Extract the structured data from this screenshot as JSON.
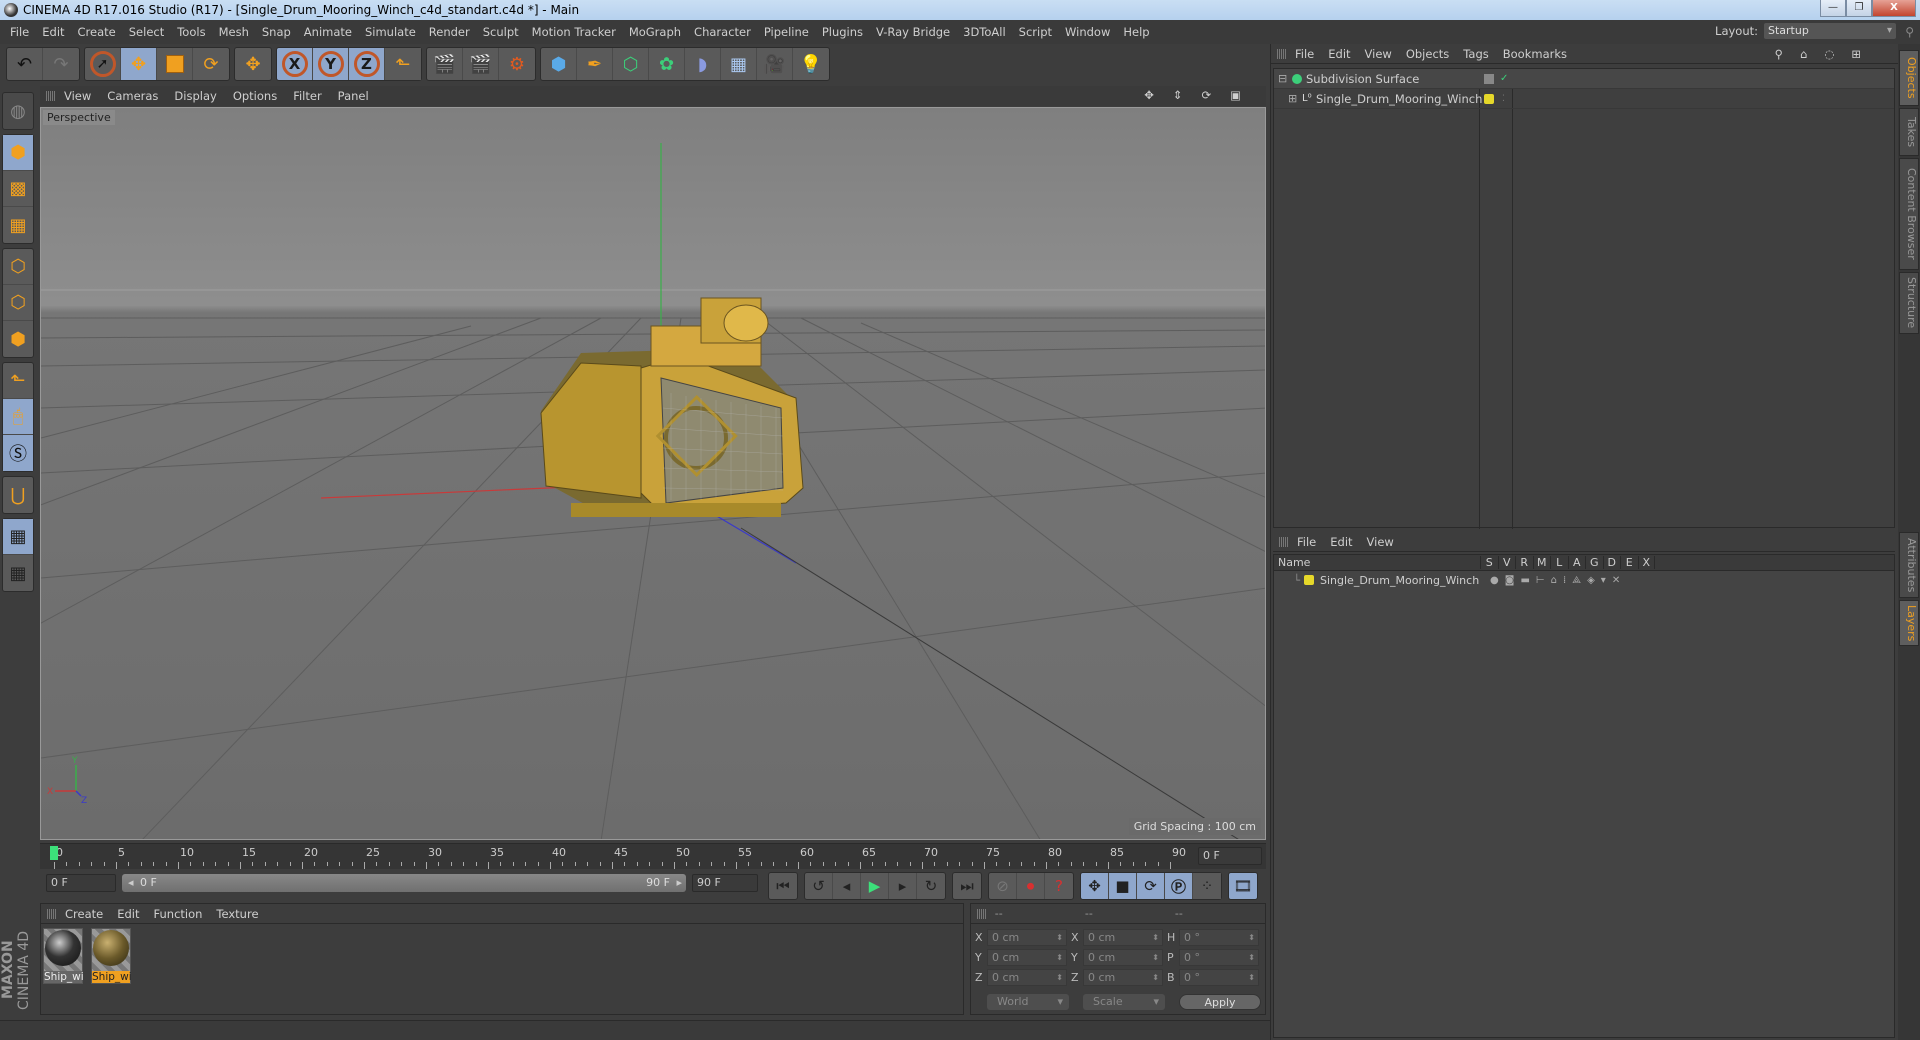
{
  "window": {
    "title": "CINEMA 4D R17.016 Studio (R17) - [Single_Drum_Mooring_Winch_c4d_standart.c4d *] - Main",
    "buttons": [
      "minimize",
      "restore",
      "close"
    ]
  },
  "menubar": {
    "items": [
      "File",
      "Edit",
      "Create",
      "Select",
      "Tools",
      "Mesh",
      "Snap",
      "Animate",
      "Simulate",
      "Render",
      "Sculpt",
      "Motion Tracker",
      "MoGraph",
      "Character",
      "Pipeline",
      "Plugins",
      "V-Ray Bridge",
      "3DToAll",
      "Script",
      "Window",
      "Help"
    ],
    "layout_label": "Layout:",
    "layout_value": "Startup"
  },
  "toolbar": {
    "icons": [
      "undo-icon",
      "redo-icon",
      "live-selection-icon",
      "move-icon",
      "scale-icon",
      "rotate-icon",
      "move-alt-icon",
      "x-axis-icon",
      "y-axis-icon",
      "z-axis-icon",
      "coordinate-system-icon",
      "render-view-icon",
      "render-picture-viewer-icon",
      "render-settings-icon",
      "cube-icon",
      "pen-icon",
      "subdivision-icon",
      "array-icon",
      "deformer-icon",
      "floor-icon",
      "camera-icon",
      "light-icon"
    ],
    "axis_labels": [
      "X",
      "Y",
      "Z"
    ]
  },
  "left_tools": [
    "make-editable-icon",
    "model-mode-icon",
    "texture-mode-icon",
    "workplane-mode-icon",
    "points-mode-icon",
    "edges-mode-icon",
    "polygons-mode-icon",
    "axis-mode-icon",
    "tweak-mode-icon",
    "solo-icon",
    "snap-magnet-icon",
    "lock-workplane-icon",
    "workplane-cycle-icon"
  ],
  "viewport": {
    "menu": [
      "View",
      "Cameras",
      "Display",
      "Options",
      "Filter",
      "Panel"
    ],
    "camera_label": "Perspective",
    "grid_spacing": "Grid Spacing : 100 cm",
    "axis_labels": {
      "x": "X",
      "y": "Y",
      "z": "Z"
    },
    "nav_icons": [
      "pan-icon",
      "zoom-icon",
      "orbit-icon",
      "maximize-icon"
    ]
  },
  "timeline": {
    "ticks": [
      "0",
      "5",
      "10",
      "15",
      "20",
      "25",
      "30",
      "35",
      "40",
      "45",
      "50",
      "55",
      "60",
      "65",
      "70",
      "75",
      "80",
      "85",
      "90"
    ],
    "current_frame": "0 F",
    "start_field": "0 F",
    "range_start": "0 F",
    "range_end": "90 F",
    "end_field": "90 F"
  },
  "transport": {
    "buttons": [
      "go-to-start-icon",
      "previous-key-icon",
      "previous-frame-icon",
      "play-icon",
      "next-frame-icon",
      "next-key-icon",
      "go-to-end-icon"
    ],
    "record": [
      "record-keys-off-icon",
      "record-active-icon",
      "autokey-icon"
    ],
    "key_modes": [
      "key-position-icon",
      "key-scale-icon",
      "key-rotation-icon",
      "key-parameter-icon",
      "key-pla-icon"
    ],
    "timeline_icon": "timeline-window-icon"
  },
  "materials": {
    "menu": [
      "Create",
      "Edit",
      "Function",
      "Texture"
    ],
    "items": [
      {
        "label": "Ship_wi",
        "selected": false,
        "color": "#3a3a3a"
      },
      {
        "label": "Ship_wi",
        "selected": true,
        "color": "#6b5a2a"
      }
    ]
  },
  "brand": {
    "maxon": "MAXON",
    "product": "CINEMA 4D"
  },
  "coordinates": {
    "headers": [
      "--",
      "--",
      "--"
    ],
    "rows": [
      {
        "a": "X",
        "pos": "0 cm",
        "b": "X",
        "size": "0 cm",
        "c": "H",
        "rot": "0 °"
      },
      {
        "a": "Y",
        "pos": "0 cm",
        "b": "Y",
        "size": "0 cm",
        "c": "P",
        "rot": "0 °"
      },
      {
        "a": "Z",
        "pos": "0 cm",
        "b": "Z",
        "size": "0 cm",
        "c": "B",
        "rot": "0 °"
      }
    ],
    "mode": "World",
    "size_mode": "Scale",
    "apply_label": "Apply"
  },
  "object_manager": {
    "menu": [
      "File",
      "Edit",
      "View",
      "Objects",
      "Tags",
      "Bookmarks"
    ],
    "objects": [
      {
        "name": "Subdivision Surface",
        "expander": "⊟",
        "icon": "subdivision-surface-icon"
      },
      {
        "name": "Single_Drum_Mooring_Winch",
        "expander": "⊞",
        "icon": "null-object-icon"
      }
    ]
  },
  "layer_manager": {
    "menu": [
      "File",
      "Edit",
      "View"
    ],
    "columns": [
      "Name",
      "S",
      "V",
      "R",
      "M",
      "L",
      "A",
      "G",
      "D",
      "E",
      "X"
    ],
    "layers": [
      {
        "name": "Single_Drum_Mooring_Winch",
        "color": "#e6d82a"
      }
    ]
  },
  "side_tabs": {
    "top": [
      {
        "label": "Objects",
        "active": true
      },
      {
        "label": "Takes",
        "active": false
      },
      {
        "label": "Content Browser",
        "active": false
      },
      {
        "label": "Structure",
        "active": false
      }
    ],
    "bottom": [
      {
        "label": "Attributes",
        "active": false
      },
      {
        "label": "Layers",
        "active": true
      }
    ]
  }
}
